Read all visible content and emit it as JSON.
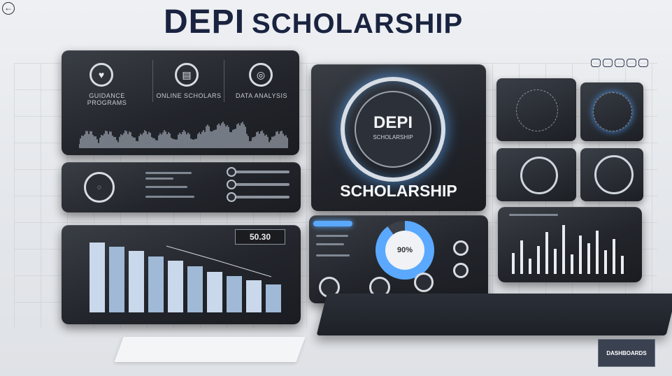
{
  "title": {
    "part1": "DEPI",
    "part2": "SCHOLARSHIP"
  },
  "center_card": {
    "ring_title": "DEPI",
    "ring_subtitle": "SCHOLARSHIP",
    "label": "SCHOLARSHIP"
  },
  "top_left_panel": {
    "items": [
      {
        "label": "GUIDANCE PROGRAMS"
      },
      {
        "label": "ONLINE SCHOLARS"
      },
      {
        "label": "DATA ANALYSIS"
      }
    ]
  },
  "value_readout": "50.30",
  "donut_label": "90%",
  "badge_label": "DASHBOARDS",
  "accent_colors": {
    "glow": "#5aa9ff",
    "dark_panel": "#22252b",
    "title": "#1a2440"
  }
}
